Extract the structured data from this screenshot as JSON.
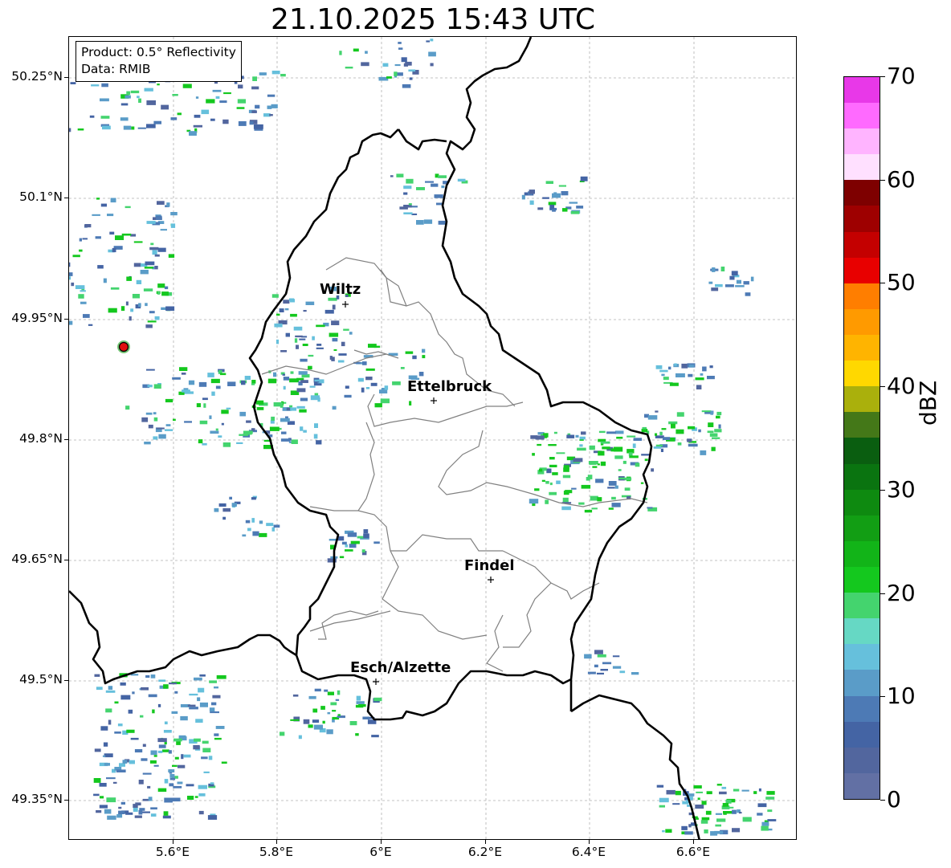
{
  "title": "21.10.2025 15:43 UTC",
  "info": {
    "product": "Product: 0.5° Reflectivity",
    "data": "Data: RMIB"
  },
  "lat_labels": [
    "50.25°N",
    "50.1°N",
    "49.95°N",
    "49.8°N",
    "49.65°N",
    "49.5°N",
    "49.35°N"
  ],
  "lon_labels": [
    "5.6°E",
    "5.8°E",
    "6°E",
    "6.2°E",
    "6.4°E",
    "6.6°E"
  ],
  "cities": [
    {
      "name": "Wiltz"
    },
    {
      "name": "Ettelbruck"
    },
    {
      "name": "Findel"
    },
    {
      "name": "Esch/Alzette"
    }
  ],
  "colorbar": {
    "unit": "dBZ",
    "ticks": [
      "0",
      "10",
      "20",
      "30",
      "40",
      "50",
      "60",
      "70"
    ],
    "range": [
      0,
      70
    ],
    "colors": [
      "#6270a4",
      "#52669e",
      "#4464a4",
      "#4d7ab5",
      "#5a9cc8",
      "#66c0dc",
      "#66d8c4",
      "#44d46e",
      "#14c81e",
      "#12b418",
      "#129e14",
      "#0e8a10",
      "#0a7410",
      "#0a5e10",
      "#447818",
      "#aab00c",
      "#ffd800",
      "#ffb400",
      "#ff9a00",
      "#ff7e00",
      "#e80000",
      "#c40000",
      "#9e0000",
      "#7e0000",
      "#ffe0ff",
      "#ffb4ff",
      "#ff6aff",
      "#e838e8"
    ]
  },
  "radar": {
    "site": "radar-site"
  }
}
